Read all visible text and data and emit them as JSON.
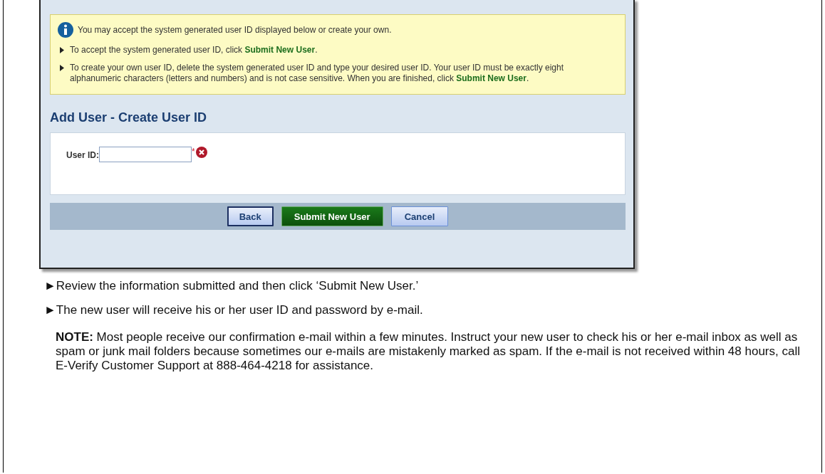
{
  "screenshot": {
    "info_intro": "You may accept the system generated user ID displayed below or create your own.",
    "info_items": [
      "To accept the system generated user ID, click **Submit New User**.",
      "To create your own user ID, delete the system generated user ID and type your desired user ID. Your user ID must be exactly eight alphanumeric characters (letters and numbers) and is not case sensitive. When you are finished, click **Submit New User**."
    ],
    "heading": "Add User - Create User ID",
    "field": {
      "label": "User ID:",
      "required_mark": "*",
      "error": true
    },
    "buttons": [
      {
        "label": "Back",
        "kind": "focused"
      },
      {
        "label": "Submit New User",
        "kind": "primary"
      },
      {
        "label": "Cancel",
        "kind": "secondary"
      }
    ]
  },
  "steps": [
    {
      "marker": "►",
      "text": "Review the information submitted and then click ‘Submit New User.’"
    },
    {
      "marker": "►",
      "text": "The new user will receive his or her user ID and password by e-mail."
    }
  ],
  "note": "**NOTE:** Most people receive our confirmation e-mail within a few minutes. Instruct your new user to check his or her e-mail inbox as well as spam or junk mail folders because sometimes our e-mails are mistakenly marked as spam. If the e-mail is not received within 48 hours, call E-Verify Customer Support at 888-464-4218 for assistance."
}
